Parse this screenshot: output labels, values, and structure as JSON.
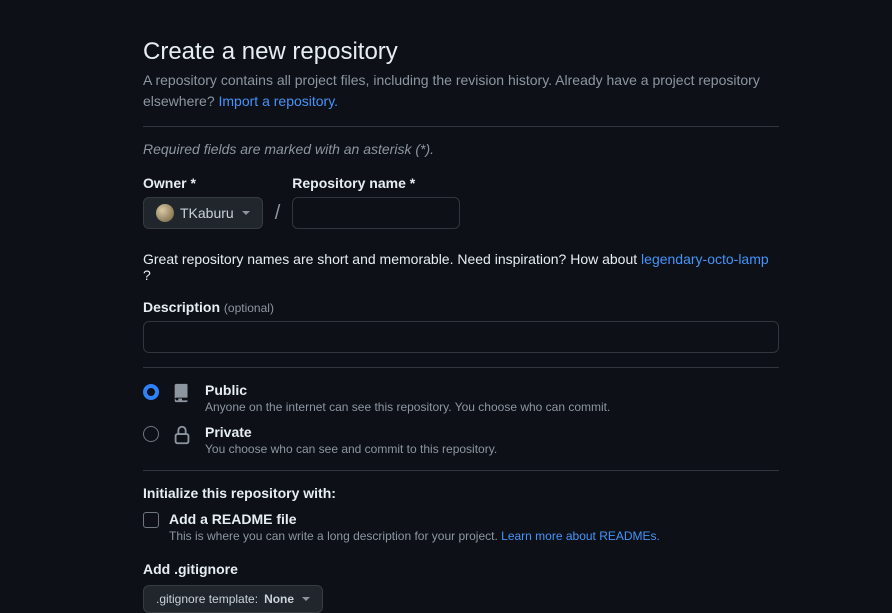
{
  "header": {
    "title": "Create a new repository",
    "subtitle_a": "A repository contains all project files, including the revision history. Already have a project repository elsewhere?",
    "import_link": "Import a repository."
  },
  "required_note": "Required fields are marked with an asterisk (*).",
  "owner": {
    "label": "Owner *",
    "name": "TKaburu"
  },
  "repo_name": {
    "label": "Repository name *",
    "value": ""
  },
  "hint": {
    "prefix": "Great repository names are short and memorable. Need inspiration? How about ",
    "suggestion": "legendary-octo-lamp",
    "suffix": " ?"
  },
  "description": {
    "label": "Description",
    "optional": "(optional)",
    "value": ""
  },
  "visibility": {
    "public": {
      "title": "Public",
      "sub": "Anyone on the internet can see this repository. You choose who can commit."
    },
    "private": {
      "title": "Private",
      "sub": "You choose who can see and commit to this repository."
    }
  },
  "init": {
    "heading": "Initialize this repository with:",
    "readme": {
      "title": "Add a README file",
      "sub_a": "This is where you can write a long description for your project. ",
      "sub_link": "Learn more about READMEs."
    }
  },
  "gitignore": {
    "label": "Add .gitignore",
    "button_prefix": ".gitignore template:",
    "button_value": "None"
  }
}
